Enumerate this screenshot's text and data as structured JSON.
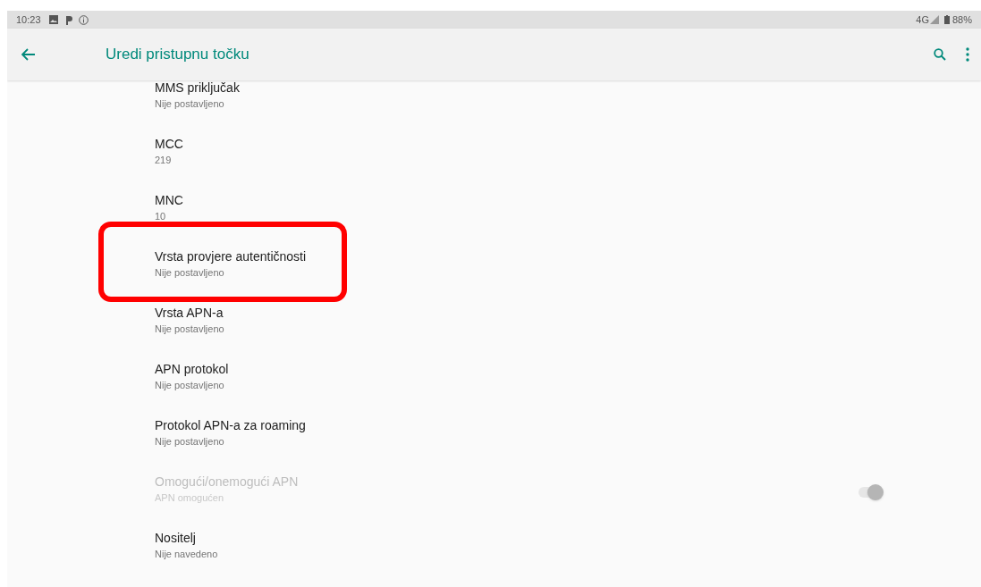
{
  "status_bar": {
    "time": "10:23",
    "network": "4G",
    "battery": "88%"
  },
  "app_bar": {
    "title": "Uredi pristupnu točku"
  },
  "items": [
    {
      "kind": "text",
      "title": "MMS priključak",
      "summary": "Nije postavljeno",
      "disabled": false,
      "highlighted": false
    },
    {
      "kind": "text",
      "title": "MCC",
      "summary": "219",
      "disabled": false,
      "highlighted": false
    },
    {
      "kind": "text",
      "title": "MNC",
      "summary": "10",
      "disabled": false,
      "highlighted": false
    },
    {
      "kind": "text",
      "title": "Vrsta provjere autentičnosti",
      "summary": "Nije postavljeno",
      "disabled": false,
      "highlighted": true
    },
    {
      "kind": "text",
      "title": "Vrsta APN-a",
      "summary": "Nije postavljeno",
      "disabled": false,
      "highlighted": false
    },
    {
      "kind": "text",
      "title": "APN protokol",
      "summary": "Nije postavljeno",
      "disabled": false,
      "highlighted": false
    },
    {
      "kind": "text",
      "title": "Protokol APN-a za roaming",
      "summary": "Nije postavljeno",
      "disabled": false,
      "highlighted": false
    },
    {
      "kind": "switch",
      "title": "Omogući/onemogući APN",
      "summary": "APN omogućen",
      "disabled": true,
      "on": true,
      "highlighted": false
    },
    {
      "kind": "text",
      "title": "Nositelj",
      "summary": "Nije navedeno",
      "disabled": false,
      "highlighted": false
    }
  ]
}
